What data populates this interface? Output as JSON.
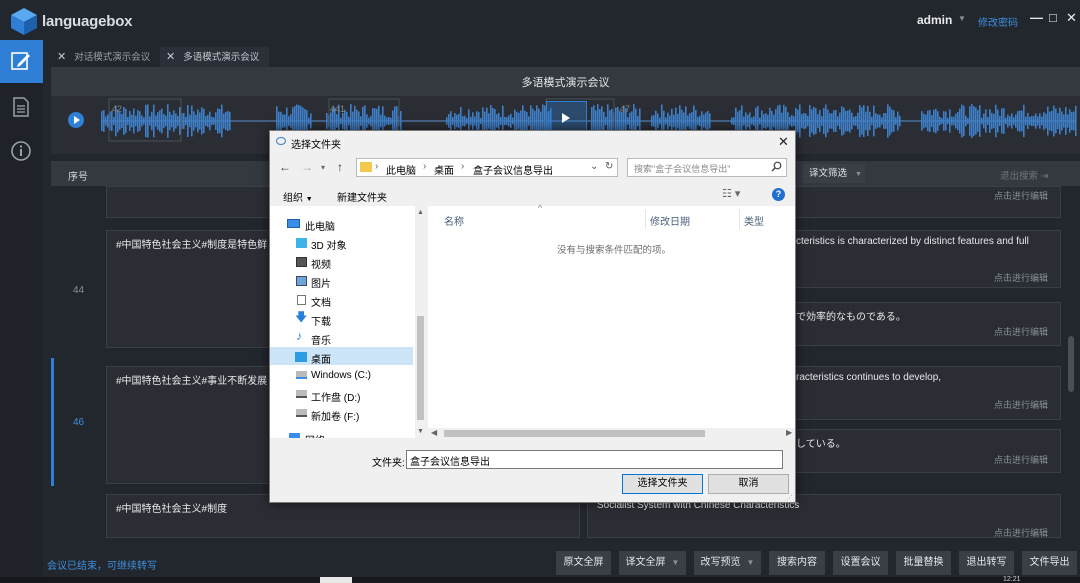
{
  "app": {
    "logo_text": "languagebox",
    "user": "admin",
    "change_password": "修改密码"
  },
  "tabs": [
    {
      "label": "对话模式演示会议"
    },
    {
      "label": "多语模式演示会议"
    }
  ],
  "meeting": {
    "title": "多语模式演示会议"
  },
  "waveform": {
    "markers": [
      "42",
      "441",
      "47"
    ]
  },
  "table": {
    "col_seq": "序号",
    "translation_filter": "译文筛选",
    "exit_search": "退出搜索",
    "edit_hint": "点击进行编辑",
    "rows": [
      {
        "num": "44",
        "source": "#中国特色社会主义#制度是特色鲜",
        "translation_1": "cteristics is characterized by distinct features and full",
        "translation_2": "で効率的なものである。"
      },
      {
        "num": "46",
        "source": "#中国特色社会主义#事业不断发展",
        "translation_1": "racteristics continues to develop,",
        "translation_2": "している。"
      },
      {
        "num": "",
        "source": "#中国特色社会主义#制度",
        "translation_1": "Socialist System with Chinese Characteristics",
        "translation_2": ""
      }
    ]
  },
  "status": "会议已结束，可继续转写",
  "bottom_buttons": [
    {
      "label": "原文全屏"
    },
    {
      "label": "译文全屏"
    },
    {
      "label": "改写预览"
    },
    {
      "label": "搜索内容"
    },
    {
      "label": "设置会议"
    },
    {
      "label": "批量替换"
    },
    {
      "label": "退出转写"
    },
    {
      "label": "文件导出"
    }
  ],
  "taskbar_time": "12:21",
  "dialog": {
    "title": "选择文件夹",
    "breadcrumb": [
      "此电脑",
      "桌面",
      "盒子会议信息导出"
    ],
    "search_placeholder": "搜索\"盒子会议信息导出\"",
    "organize": "组织",
    "new_folder": "新建文件夹",
    "nav": [
      "此电脑",
      "3D 对象",
      "视频",
      "图片",
      "文档",
      "下载",
      "音乐",
      "桌面",
      "Windows (C:)",
      "工作盘 (D:)",
      "新加卷 (F:)",
      "网络"
    ],
    "columns": {
      "name": "名称",
      "modified": "修改日期",
      "type": "类型"
    },
    "empty_message": "没有与搜索条件匹配的项。",
    "folder_label": "文件夹:",
    "folder_value": "盒子会议信息导出",
    "select_button": "选择文件夹",
    "cancel_button": "取消"
  }
}
